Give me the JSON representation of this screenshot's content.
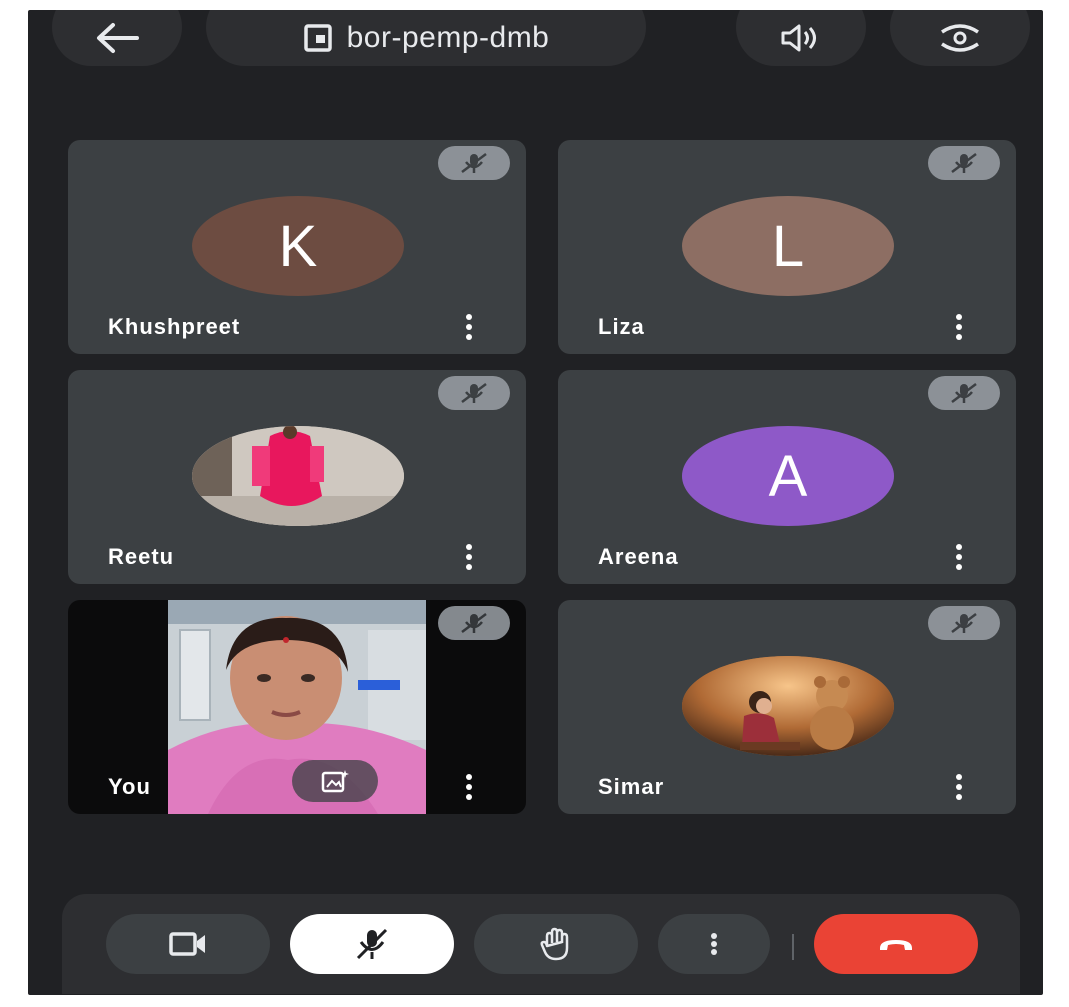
{
  "meeting": {
    "code": "bor-pemp-dmb"
  },
  "participants": [
    {
      "name": "Khushpreet",
      "initial": "K",
      "avatar_color": "#6d4c41",
      "muted": true
    },
    {
      "name": "Liza",
      "initial": "L",
      "avatar_color": "#8d6e63",
      "muted": true
    },
    {
      "name": "Reetu",
      "initial": "",
      "avatar_color": "#e8e0d8",
      "muted": true,
      "photo": true
    },
    {
      "name": "Areena",
      "initial": "A",
      "avatar_color": "#8e59c8",
      "muted": true
    },
    {
      "name": "You",
      "initial": "",
      "avatar_color": "#0b0b0c",
      "muted": true,
      "self_video": true
    },
    {
      "name": "Simar",
      "initial": "",
      "avatar_color": "#b0703a",
      "muted": true,
      "photo": true
    }
  ],
  "icons": {
    "back": "arrow-left-icon",
    "meeting": "meeting-room-icon",
    "speaker": "speaker-icon",
    "flip": "flip-camera-icon",
    "muted": "mic-off-icon",
    "more": "more-vert-icon",
    "effects": "effects-icon",
    "camera": "video-camera-icon",
    "mic": "mic-off-icon",
    "hand": "raise-hand-icon",
    "end": "end-call-icon"
  },
  "colors": {
    "background": "#202124",
    "tile": "#3c4043",
    "end_call": "#ea4335",
    "mic_active_bg": "#ffffff"
  }
}
